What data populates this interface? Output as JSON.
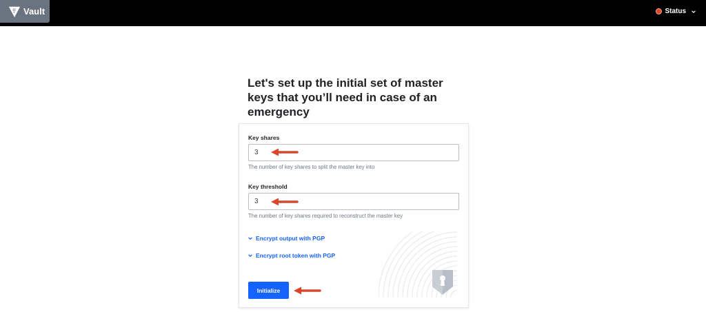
{
  "navbar": {
    "brand_label": "Vault",
    "status_label": "Status",
    "status_color": "#e0472f"
  },
  "page": {
    "title": "Let's set up the initial set of master keys that you’ll need in case of an emergency"
  },
  "form": {
    "key_shares": {
      "label": "Key shares",
      "value": "3",
      "help": "The number of key shares to split the master key into"
    },
    "key_threshold": {
      "label": "Key threshold",
      "value": "3",
      "help": "The number of key shares required to reconstruct the master key"
    },
    "toggles": [
      {
        "label": "Encrypt output with PGP",
        "icon": "chevron-down-icon"
      },
      {
        "label": "Encrypt root token with PGP",
        "icon": "chevron-down-icon"
      }
    ],
    "submit_label": "Initialize",
    "accent_color": "#1563ff"
  },
  "annotations": {
    "arrow_color": "#d9472b"
  }
}
